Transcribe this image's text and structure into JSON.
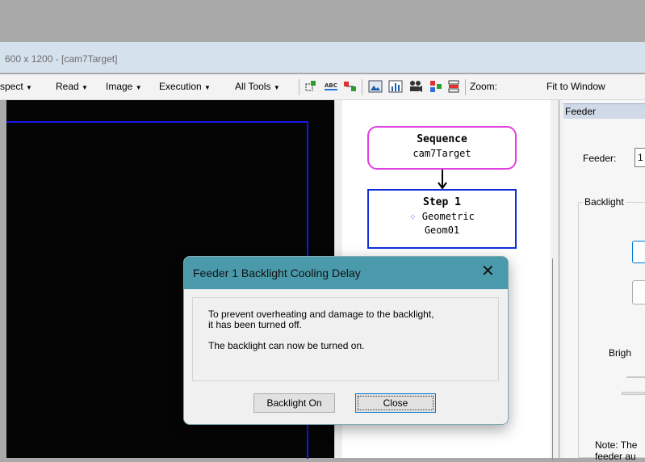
{
  "window": {
    "title": "600 x 1200 - [cam7Target]"
  },
  "menu": [
    {
      "name": "menu-inspect",
      "label": "spect"
    },
    {
      "name": "menu-read",
      "label": "Read"
    },
    {
      "name": "menu-image",
      "label": "Image"
    },
    {
      "name": "menu-execution",
      "label": "Execution"
    },
    {
      "name": "menu-all-tools",
      "label": "All Tools"
    }
  ],
  "zoom": {
    "label": "Zoom:",
    "value": "Fit to Window"
  },
  "sequence": {
    "node_title": "Sequence",
    "node_name": "cam7Target",
    "step_title": "Step 1",
    "step_type": "Geometric",
    "step_name": "Geom01"
  },
  "feeder_panel": {
    "header": "Feeder",
    "feeder_label": "Feeder:",
    "feeder_value": "1",
    "backlight_group": "Backlight",
    "brightness_label": "Brigh",
    "note_line1": "Note: The",
    "note_line2": "feeder au"
  },
  "dialog": {
    "title": "Feeder 1 Backlight Cooling Delay",
    "message_line1": "To prevent overheating and damage to the backlight,",
    "message_line2": "it has been turned off.",
    "message_line3": "The backlight can now be turned on.",
    "backlight_on_label": "Backlight On",
    "close_label": "Close"
  },
  "colors": {
    "dialog_titlebar": "#4a9aab",
    "sequence_border": "#e23ee2",
    "step_border": "#1230d8",
    "roi_border": "#1416e8"
  }
}
